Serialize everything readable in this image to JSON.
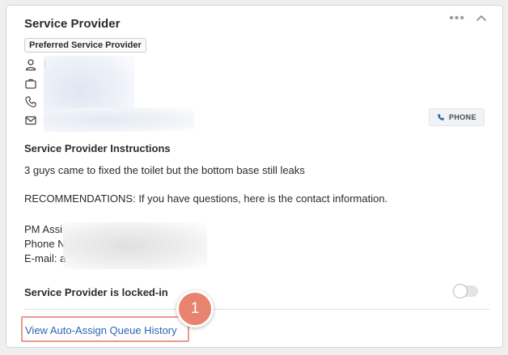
{
  "card": {
    "title": "Service Provider",
    "badge": "Preferred Service Provider",
    "contacts": [
      {
        "icon": "user-icon",
        "value": "l"
      },
      {
        "icon": "briefcase-icon",
        "value": "l"
      },
      {
        "icon": "phone-icon",
        "value": "("
      },
      {
        "icon": "mail-icon",
        "value": "c"
      }
    ],
    "phone_button": "PHONE"
  },
  "instructions": {
    "title": "Service Provider Instructions",
    "line1": "3 guys came to fixed the toilet but the bottom base still leaks",
    "line2": "RECOMMENDATIONS: If you have questions, here is the contact information.",
    "line3": "PM Assi",
    "line4": "Phone N",
    "line5": "E-mail: a"
  },
  "locked": {
    "label": "Service Provider is locked-in",
    "enabled": false
  },
  "queue_link": "View Auto-Assign Queue History",
  "step_number": "1",
  "colors": {
    "link": "#2f62b6",
    "highlight": "#e99a8c",
    "step_badge": "#e7836f"
  }
}
